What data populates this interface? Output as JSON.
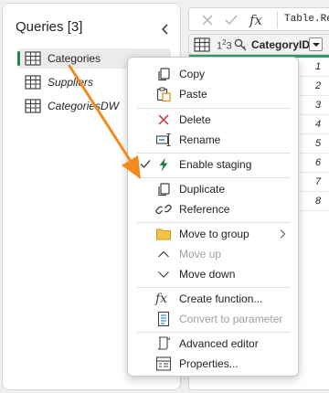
{
  "queries_pane": {
    "title": "Queries [3]",
    "items": [
      {
        "label": "Categories",
        "selected": true,
        "italic": false
      },
      {
        "label": "Suppliers",
        "selected": false,
        "italic": true
      },
      {
        "label": "CategoriesDW",
        "selected": false,
        "italic": true
      }
    ]
  },
  "formula_bar": {
    "fx_label": "fx",
    "text": "Table.Re"
  },
  "grid": {
    "column": {
      "type_label": "1",
      "type_sup": "2",
      "type_label2": "3",
      "name": "CategoryID"
    },
    "row_values": [
      "1",
      "2",
      "3",
      "4",
      "5",
      "6",
      "7",
      "8"
    ]
  },
  "context_menu": {
    "items": [
      {
        "key": "copy",
        "label": "Copy",
        "icon": "copy-icon",
        "disabled": false
      },
      {
        "key": "paste",
        "label": "Paste",
        "icon": "paste-icon",
        "disabled": false
      },
      {
        "key": "delete",
        "label": "Delete",
        "icon": "delete-icon",
        "disabled": false
      },
      {
        "key": "rename",
        "label": "Rename",
        "icon": "rename-icon",
        "disabled": false
      },
      {
        "key": "enable-staging",
        "label": "Enable staging",
        "icon": "lightning-icon",
        "checked": true,
        "disabled": false
      },
      {
        "key": "duplicate",
        "label": "Duplicate",
        "icon": "duplicate-icon",
        "disabled": false
      },
      {
        "key": "reference",
        "label": "Reference",
        "icon": "reference-icon",
        "disabled": false
      },
      {
        "key": "move-to-group",
        "label": "Move to group",
        "icon": "folder-icon",
        "disabled": false,
        "submenu": true
      },
      {
        "key": "move-up",
        "label": "Move up",
        "icon": "chevron-up-icon",
        "disabled": true
      },
      {
        "key": "move-down",
        "label": "Move down",
        "icon": "chevron-down-icon",
        "disabled": false
      },
      {
        "key": "create-function",
        "label": "Create function...",
        "icon": "function-icon",
        "disabled": false
      },
      {
        "key": "convert-to-parameter",
        "label": "Convert to parameter",
        "icon": "parameter-icon",
        "disabled": true
      },
      {
        "key": "advanced-editor",
        "label": "Advanced editor",
        "icon": "advanced-editor-icon",
        "disabled": false
      },
      {
        "key": "properties",
        "label": "Properties...",
        "icon": "properties-icon",
        "disabled": false
      }
    ]
  },
  "colors": {
    "accent_green": "#1f8a4c",
    "quality_bar": "#2f9e64",
    "annotation_arrow": "#f28a1e",
    "delete_red": "#d13438",
    "folder_yellow": "#f5c343"
  }
}
